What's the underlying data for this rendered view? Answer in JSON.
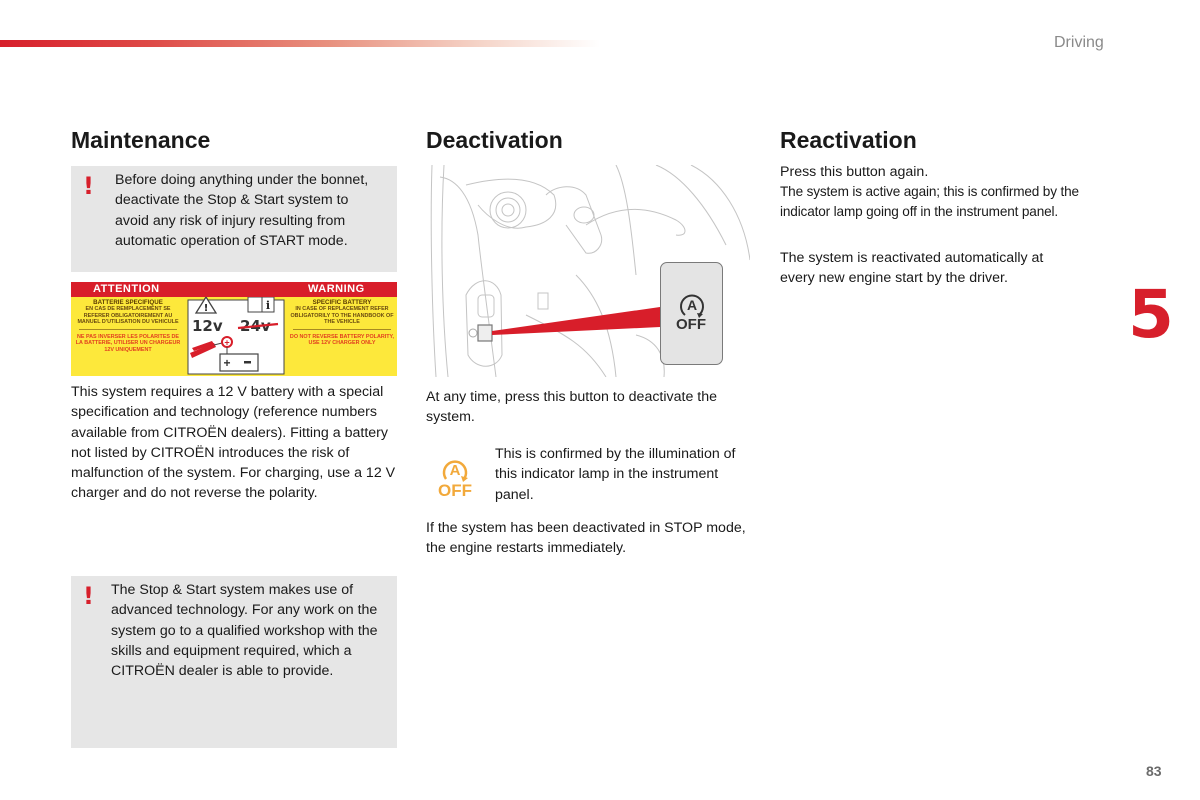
{
  "header": {
    "section": "Driving"
  },
  "chapter_number": "5",
  "page_number": "83",
  "colors": {
    "accent_red": "#d71f2b",
    "note_bg": "#e6e6e6",
    "lamp_orange": "#f2a93b",
    "label_yellow": "#fde83b"
  },
  "maintenance": {
    "title": "Maintenance",
    "warning1": "Before doing anything under the bonnet, deactivate the Stop & Start system to avoid any risk of injury resulting from automatic operation of START mode.",
    "battery_label": {
      "left_header": "ATTENTION",
      "right_header": "WARNING",
      "left_title": "BATTERIE SPECIFIQUE",
      "left_body": "EN CAS DE REMPLACEMENT SE REFERER OBLIGATOIREMENT AU MANUEL D'UTILISATION DU VEHICULE",
      "left_warning": "NE PAS INVERSER LES POLARITES DE LA BATTERIE, UTILISER UN CHARGEUR 12V UNIQUEMENT",
      "right_title": "SPECIFIC BATTERY",
      "right_body": "IN CASE OF REPLACEMENT REFER OBLIGATORILY TO THE HANDBOOK OF THE VEHICLE",
      "right_warning": "DO NOT REVERSE BATTERY POLARITY, USE 12V CHARGER ONLY",
      "voltage_ok": "12v",
      "voltage_no": "24v"
    },
    "body": "This system requires a 12 V battery with a special specification and technology (reference numbers available from CITROËN dealers). Fitting a battery not listed by CITROËN introduces the risk of malfunction of the system. For charging, use a 12 V charger and do not reverse the polarity.",
    "warning2": "The Stop & Start system makes use of advanced technology. For any work on the system go to a qualified workshop with the skills and equipment required, which a CITROËN dealer is able to provide."
  },
  "deactivation": {
    "title": "Deactivation",
    "button_label_top": "A",
    "button_label_bottom": "OFF",
    "body": "At any time, press this button to deactivate the system.",
    "lamp_note": "This is confirmed by the illumination of this indicator lamp in the instrument panel.",
    "stop_note": "If the system has been deactivated in STOP mode, the engine restarts immediately."
  },
  "reactivation": {
    "title": "Reactivation",
    "line1": "Press this button again.",
    "line2": "The system is active again; this is confirmed by the indicator lamp going off in the instrument panel.",
    "body2": "The system is reactivated automatically at every new engine start by the driver."
  }
}
